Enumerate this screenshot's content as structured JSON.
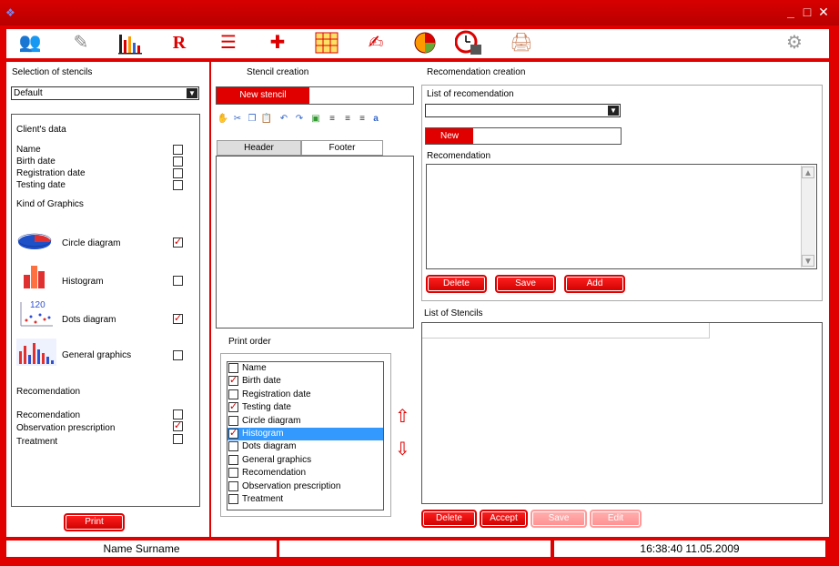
{
  "window": {
    "minimize": "_",
    "maximize": "□",
    "close": "✕"
  },
  "toolbar": {
    "tools": [
      "clients-icon",
      "pen-icon",
      "bar-chart-icon",
      "rx-icon",
      "checklist-icon",
      "puzzle-hz-icon",
      "grid-table-icon",
      "notes-icon",
      "pie-chart-icon",
      "calendar-clock-icon",
      "printer-icon",
      "gear-icon"
    ]
  },
  "left": {
    "title": "Selection of stencils",
    "stencil_select": "Default",
    "clients_data_title": "Client's data",
    "clients_data": [
      {
        "label": "Name",
        "checked": false
      },
      {
        "label": "Birth date",
        "checked": false
      },
      {
        "label": "Registration date",
        "checked": false
      },
      {
        "label": "Testing date",
        "checked": false
      }
    ],
    "kind_title": "Kind of Graphics",
    "graphics": [
      {
        "label": "Circle diagram",
        "checked": true,
        "icon": "circle-diagram-icon"
      },
      {
        "label": "Histogram",
        "checked": false,
        "icon": "histogram-icon"
      },
      {
        "label": "Dots diagram",
        "checked": true,
        "icon": "dots-diagram-icon"
      },
      {
        "label": "General graphics",
        "checked": false,
        "icon": "general-graphics-icon"
      }
    ],
    "dots_icon_text": "120",
    "recomendation_title": "Recomendation",
    "recomendation": [
      {
        "label": "Recomendation",
        "checked": false
      },
      {
        "label": "Observation prescription",
        "checked": true
      },
      {
        "label": "Treatment",
        "checked": false
      }
    ],
    "print_label": "Print"
  },
  "stencil": {
    "title": "Stencil creation",
    "new_stencil_label": "New stencil",
    "new_stencil_value": "",
    "tabs": [
      "Header",
      "Footer"
    ],
    "print_order_title": "Print order",
    "print_order": [
      {
        "label": "Name",
        "checked": false
      },
      {
        "label": "Birth date",
        "checked": true
      },
      {
        "label": "Registration date",
        "checked": false
      },
      {
        "label": "Testing date",
        "checked": true
      },
      {
        "label": "Circle diagram",
        "checked": false
      },
      {
        "label": "Histogram",
        "checked": true,
        "selected": true
      },
      {
        "label": "Dots diagram",
        "checked": false
      },
      {
        "label": "General graphics",
        "checked": false
      },
      {
        "label": "Recomendation",
        "checked": false
      },
      {
        "label": "Observation prescription",
        "checked": false
      },
      {
        "label": "Treatment",
        "checked": false
      }
    ],
    "up_arrow": "⇧",
    "down_arrow": "⇩"
  },
  "recomendation_creation": {
    "title": "Recomendation creation",
    "list_label": "List of recomendation",
    "list_value": "",
    "new_label": "New",
    "new_value": "",
    "recomendation_label": "Recomendation",
    "buttons": {
      "delete": "Delete",
      "save": "Save",
      "add": "Add"
    }
  },
  "stencils_list": {
    "title": "List of Stencils",
    "buttons": {
      "delete": "Delete",
      "accept": "Accept",
      "save": "Save",
      "edit": "Edit"
    }
  },
  "status": {
    "user": "Name Surname",
    "middle": "",
    "datetime": "16:38:40  11.05.2009"
  },
  "colors": {
    "accent": "#e00000",
    "selection": "#3399ff",
    "check": "#d00000"
  }
}
